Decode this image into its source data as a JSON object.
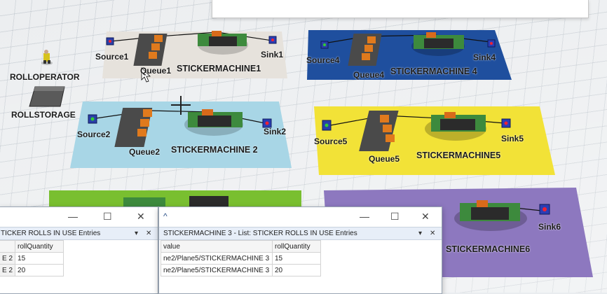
{
  "scene": {
    "objects": {
      "source1": "Source1",
      "queue1": "Queue1",
      "machine1": "STICKERMACHINE1",
      "sink1": "Sink1",
      "source4": "Source4",
      "queue4": "Queue4",
      "machine4": "STICKERMACHINE 4",
      "sink4": "Sink4",
      "rolloperator": "ROLLOPERATOR",
      "rollstorage": "ROLLSTORAGE",
      "source2": "Source2",
      "queue2": "Queue2",
      "machine2": "STICKERMACHINE 2",
      "sink2": "Sink2",
      "source5": "Source5",
      "queue5": "Queue5",
      "machine5": "STICKERMACHINE5",
      "sink5": "Sink5",
      "sink6": "Sink6",
      "machine6": "STICKERMACHINE6"
    },
    "colors": {
      "plane1": "#e6e2dc",
      "plane4": "#1f4f9e",
      "plane2": "#a8d6e6",
      "plane5": "#f2e237",
      "plane3": "#79bf30",
      "plane6": "#8d78bf"
    }
  },
  "left_window": {
    "tab_title": "TICKER ROLLS IN USE Entries",
    "dropdown_icon": "▾",
    "close_icon": "✕",
    "columns": [
      "",
      "rollQuantity"
    ],
    "rows": [
      [
        "E 2",
        "15"
      ],
      [
        "E 2",
        "20"
      ]
    ],
    "minimize_icon": "—",
    "maximize_icon": "☐",
    "window_close_icon": "✕"
  },
  "right_window": {
    "tab_title": "STICKERMACHINE 3 - List: STICKER ROLLS IN USE Entries",
    "dropdown_icon": "▾",
    "close_icon": "✕",
    "columns": [
      "value",
      "rollQuantity"
    ],
    "rows": [
      [
        "ne2/Plane5/STICKERMACHINE 3",
        "15"
      ],
      [
        "ne2/Plane5/STICKERMACHINE 3",
        "20"
      ]
    ],
    "minimize_icon": "—",
    "maximize_icon": "☐",
    "window_close_icon": "✕",
    "collapse_icon": "^"
  }
}
